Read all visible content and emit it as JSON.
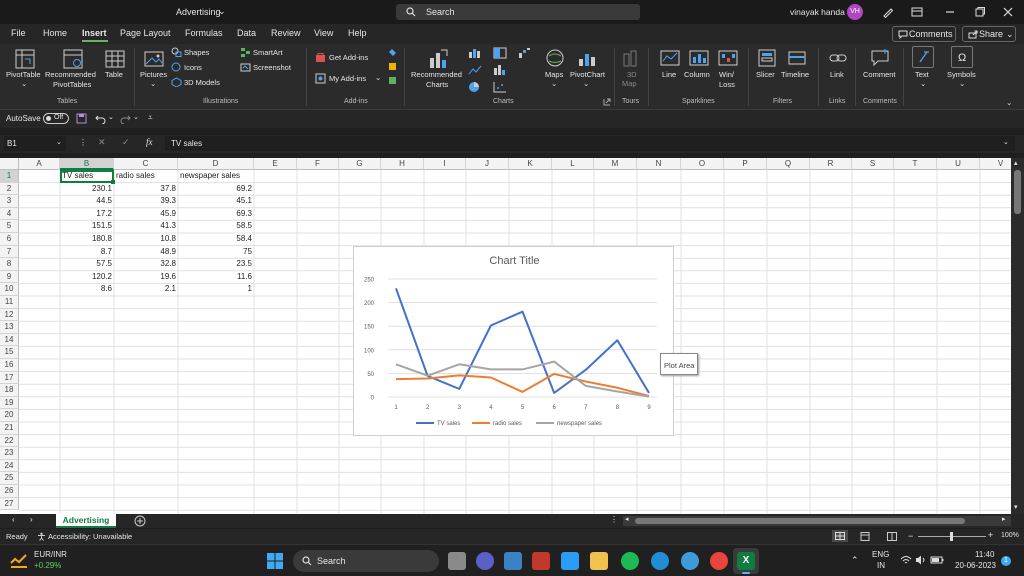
{
  "window": {
    "title": "Advertising",
    "title_suffix": "⌄",
    "search_placeholder": "Search",
    "user_name": "vinayak handa",
    "user_initials": "VH"
  },
  "menu": {
    "items": [
      "File",
      "Home",
      "Insert",
      "Page Layout",
      "Formulas",
      "Data",
      "Review",
      "View",
      "Help"
    ],
    "active": "Insert",
    "comments_label": "Comments",
    "share_label": "Share"
  },
  "ribbon": {
    "pivottable": "PivotTable",
    "recommended_pivottables": [
      "Recommended",
      "PivotTables"
    ],
    "table": "Table",
    "pictures": "Pictures",
    "shapes": "Shapes",
    "icons": "Icons",
    "models3d": "3D Models",
    "smartart": "SmartArt",
    "screenshot": "Screenshot",
    "get_addins": "Get Add-ins",
    "my_addins": "My Add-ins",
    "recommended_charts": [
      "Recommended",
      "Charts"
    ],
    "maps": "Maps",
    "pivotchart": "PivotChart",
    "map3d": [
      "3D",
      "Map"
    ],
    "line": "Line",
    "column": "Column",
    "winloss": [
      "Win/",
      "Loss"
    ],
    "slicer": "Slicer",
    "timeline": "Timeline",
    "link": "Link",
    "comment": "Comment",
    "text": "Text",
    "symbols": "Symbols",
    "groups": {
      "tables": "Tables",
      "illustrations": "Illustrations",
      "addins": "Add-ins",
      "charts": "Charts",
      "tours": "Tours",
      "sparklines": "Sparklines",
      "filters": "Filters",
      "links": "Links",
      "comments": "Comments"
    }
  },
  "qat": {
    "autosave_label": "AutoSave",
    "autosave_state": "Off"
  },
  "formula": {
    "namebox": "B1",
    "fx": "fx",
    "content": "TV sales"
  },
  "sheet": {
    "columns": [
      "A",
      "B",
      "C",
      "D",
      "E",
      "F",
      "G",
      "H",
      "I",
      "J",
      "K",
      "L",
      "M",
      "N",
      "O",
      "P",
      "Q",
      "R",
      "S",
      "T",
      "U",
      "V"
    ],
    "rows": [
      "1",
      "2",
      "3",
      "4",
      "5",
      "6",
      "7",
      "8",
      "9",
      "10",
      "11",
      "12",
      "13",
      "14",
      "15",
      "16",
      "17",
      "18",
      "19",
      "20",
      "21",
      "22",
      "23",
      "24",
      "25",
      "26",
      "27"
    ],
    "headers": [
      "TV sales",
      "radio sales",
      "newspaper sales"
    ],
    "data": [
      [
        "230.1",
        "37.8",
        "69.2"
      ],
      [
        "44.5",
        "39.3",
        "45.1"
      ],
      [
        "17.2",
        "45.9",
        "69.3"
      ],
      [
        "151.5",
        "41.3",
        "58.5"
      ],
      [
        "180.8",
        "10.8",
        "58.4"
      ],
      [
        "8.7",
        "48.9",
        "75"
      ],
      [
        "57.5",
        "32.8",
        "23.5"
      ],
      [
        "120.2",
        "19.6",
        "11.6"
      ],
      [
        "8.6",
        "2.1",
        "1"
      ]
    ]
  },
  "chart_data": {
    "type": "line",
    "title": "Chart Title",
    "x": [
      "1",
      "2",
      "3",
      "4",
      "5",
      "6",
      "7",
      "8",
      "9"
    ],
    "ylim": [
      0,
      250
    ],
    "yticks": [
      "0",
      "50",
      "100",
      "150",
      "200",
      "250"
    ],
    "grid": true,
    "legend": "bottom",
    "tooltip": "Plot Area",
    "series": [
      {
        "name": "TV sales",
        "color": "#4472c4",
        "values": [
          230.1,
          44.5,
          17.2,
          151.5,
          180.8,
          8.7,
          57.5,
          120.2,
          8.6
        ]
      },
      {
        "name": "radio sales",
        "color": "#ed7d31",
        "values": [
          37.8,
          39.3,
          45.9,
          41.3,
          10.8,
          48.9,
          32.8,
          19.6,
          2.1
        ]
      },
      {
        "name": "newspaper sales",
        "color": "#a5a5a5",
        "values": [
          69.2,
          45.1,
          69.3,
          58.5,
          58.4,
          75,
          23.5,
          11.6,
          1
        ]
      }
    ]
  },
  "tabs": {
    "sheet_name": "Advertising"
  },
  "status": {
    "ready": "Ready",
    "accessibility": "Accessibility: Unavailable",
    "zoom": "100%"
  },
  "taskbar": {
    "ticker_name": "EUR/INR",
    "ticker_change": "+0.29%",
    "search_label": "Search",
    "lang_top": "ENG",
    "lang_bottom": "IN",
    "time": "11:40",
    "date": "20-06-2023"
  }
}
